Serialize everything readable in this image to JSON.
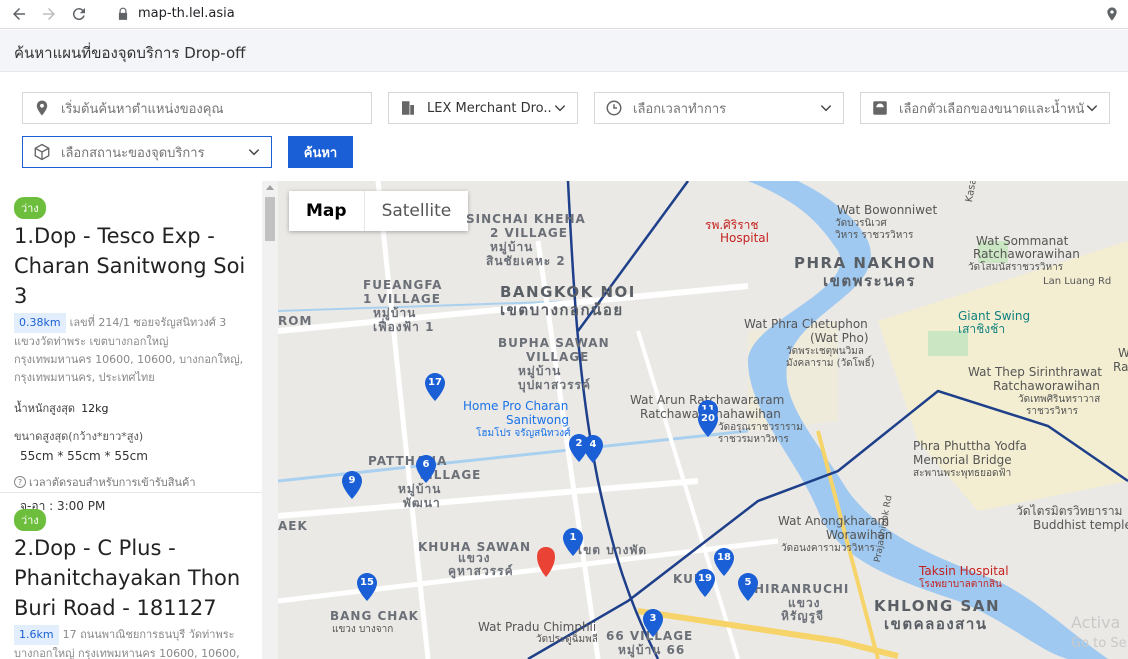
{
  "browser": {
    "url": "map-th.lel.asia",
    "back_icon": "arrow-left-icon",
    "forward_icon": "arrow-right-icon",
    "reload_icon": "reload-icon"
  },
  "header": {
    "title": "ค้นหาแผนที่ของจุดบริการ Drop-off"
  },
  "filters": {
    "location_placeholder": "เริ่มต้นค้นหาตำแหน่งของคุณ",
    "merchant_value": "LEX Merchant Dro...",
    "time_placeholder": "เลือกเวลาทำการ",
    "size_placeholder": "เลือกตัวเลือกของขนาดและน้ำหนัก",
    "status_placeholder": "เลือกสถานะของจุดบริการ",
    "search_label": "ค้นหา"
  },
  "locations": [
    {
      "badge": "ว่าง",
      "title": "1.Dop - Tesco Exp - Charan Sanitwong Soi 3",
      "distance": "0.38km",
      "address": "เลขที่ 214/1 ซอยจรัญสนิทวงศ์ 3 แขวงวัดท่าพระ เขตบางกอกใหญ่ กรุงเทพมหานคร 10600, 10600, บางกอกใหญ่, กรุงเทพมหานคร, ประเทศไทย",
      "max_weight_label": "น้ำหนักสูงสุด",
      "max_weight": "12kg",
      "max_size_label": "ขนาดสูงสุด(กว้าง*ยาว*สูง)",
      "max_size": "55cm * 55cm * 55cm",
      "cutoff_label": "เวลาตัดรอบสำหรับการเข้ารับสินค้า",
      "hours": "จ-อา : 3:00 PM"
    },
    {
      "badge": "ว่าง",
      "title": "2.Dop - C Plus - Phanitchayakan Thon Buri Road - 181127",
      "distance": "1.6km",
      "address": "17 ถนนพาณิชยการธนบุรี วัดท่าพระ บางกอกใหญ่ กรุงเทพมหานคร 10600, 10600,"
    }
  ],
  "map": {
    "type_map": "Map",
    "type_satellite": "Satellite",
    "labels": {
      "sinchai": "SINCHAI KHEHA",
      "sinchai2": "2 VILLAGE",
      "sinchai_th": "หมู่บ้าน",
      "sinchai_th2": "สินชัยเคหะ 2",
      "fueang": "FUEANGFA",
      "fueang2": "1 VILLAGE",
      "fueang_th": "หมู่บ้าน",
      "fueang_th2": "เฟื่องฟ้า 1",
      "rom": "ROM",
      "bangkok_noi": "BANGKOK NOI",
      "bangkok_noi_th": "เขตบางกอกน้อย",
      "bupha": "BUPHA SAWAN",
      "bupha2": "VILLAGE",
      "bupha_th": "หมู่บ้าน",
      "bupha_th2": "บุปผาสวรรค์",
      "homepro": "Home Pro Charan",
      "homepro2": "Sanitwong",
      "homepro_th": "โฮมโปร จรัญสนิทวงศ์",
      "phatthana": "PATTHANA",
      "phatthana2": "VILLAGE",
      "phatthana_th": "หมู่บ้าน",
      "phatthana_th2": "พัฒนา",
      "aek": "AEK",
      "khuha": "KHUHA SAWAN",
      "khuha_th": "แขวง",
      "khuha_th2": "คูหาสวรรค์",
      "phasi": "เขต บางพัด",
      "kudi": "KUDI",
      "bangchak": "BANG CHAK",
      "bangchak_th": "แขวง บางจาก",
      "pradu": "Wat Pradu Chimphli",
      "pradu_th": "วัดประดู่ฉิมพลี",
      "village66": "66 VILLAGE",
      "village66_th": "หมู่บ้าน 66",
      "siriraj_th": "รพ.ศิริราช",
      "siriraj": "Hospital",
      "bowon": "Wat Bowonniwet",
      "bowon_th": "วัดบวรนิเวศ",
      "bowon_th2": "วิหาร ราชวรวิหาร",
      "sommanat": "Wat Sommanat",
      "sommanat2": "Ratchaworawihan",
      "sommanat_th": "วัดโสมนัสราชวรวิหาร",
      "phra_nakhon": "PHRA NAKHON",
      "phra_nakhon_th": "เขตพระนคร",
      "lanluang": "Lan Luang Rd",
      "giant": "Giant Swing",
      "giant_th": "เสาชิงช้า",
      "chetuphon": "Wat Phra Chetuphon",
      "chetuphon2": "(Wat Pho)",
      "chetuphon_th": "วัดพระเชตุพนวิมล",
      "chetuphon_th2": "มังคลาราม (วัดโพธิ์)",
      "arun": "Wat Arun Ratchawararam",
      "arun2": "Ratchawaramahawihan",
      "arun_th": "วัดอรุณราชวราราม",
      "arun_th2": "ราชวรมหาวิหาร",
      "thep": "Wat Thep Sirinthrawat",
      "thep2": "Ratchaworawihan",
      "thep_th": "วัดเทพศิรินทราวาส",
      "thep_th2": "ราชวรวิหาร",
      "phuttha": "Phra Phuttha Yodfa",
      "phuttha2": "Memorial Bridge",
      "phuttha_th": "สะพานพระพุทธยอดฟ้า",
      "traimit": "วัดไตรมิตรวิทยาราม",
      "traimit2": "Buddhist temple",
      "anong": "Wat Anongkharam",
      "anong2": "Worawihan",
      "anong_th": "วัดอนงคารามวรวิหาร",
      "hiran": "HIRANRUCHI",
      "hiran_th": "แขวง",
      "hiran_th2": "หิรัญรูจี",
      "taksin": "Taksin Hospital",
      "taksin_th": "โรงพยาบาลตากสิน",
      "khlongsan": "KHLONG SAN",
      "khlongsan_th": "เขตคลองสาน",
      "prajadhipok": "Prajadhipok Rd",
      "watermark": "Activa",
      "watermark2": "Go to Se",
      "kasat": "Kasat",
      "rt": "W",
      "rt2": "Ratc"
    },
    "markers": [
      "17",
      "11",
      "20",
      "2",
      "4",
      "6",
      "9",
      "1",
      "18",
      "19",
      "5",
      "15",
      "3"
    ]
  }
}
